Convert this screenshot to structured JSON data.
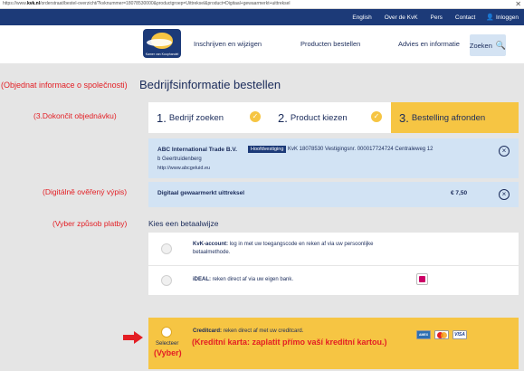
{
  "browser": {
    "url_prefix": "https://www.",
    "url_domain": "kvk.nl",
    "url_rest": "/orderstraat/bestel-overzicht/?kvknummer=18078530000&productgroep=Uittreksel&product=Digitaal+gewaarmerkt+uittreksel",
    "close": "✕"
  },
  "topbar": {
    "links": [
      "English",
      "Over de KvK",
      "Pers",
      "Contact"
    ],
    "login": "Inloggen",
    "user_icon": "👤"
  },
  "logo": {
    "text": "Kamer van Koophandel"
  },
  "nav": {
    "items": [
      "Inschrijven en wijzigen",
      "Producten bestellen",
      "Advies en informatie"
    ],
    "search": "Zoeken",
    "search_icon": "🔍"
  },
  "page": {
    "title": "Bedrijfsinformatie bestellen"
  },
  "annotations": {
    "order_info": "(Objednat informace o společnosti)",
    "complete_order": "(3.Dokončit objednávku)",
    "digital_extract": "(Digitálně ověřený výpis)",
    "payment_method": "(Vyber způsob platby)",
    "select": "(Vyber)",
    "credit_card": "(Kreditní karta: ",
    "credit_card_rest": "zaplatit přímo vaší kreditní kartou.)"
  },
  "steps": [
    {
      "num": "1.",
      "label": "Bedrijf zoeken",
      "check": "✓"
    },
    {
      "num": "2.",
      "label": "Product kiezen",
      "check": "✓"
    },
    {
      "num": "3.",
      "label": "Bestelling afronden"
    }
  ],
  "company": {
    "name": "ABC International Trade B.V.",
    "badge": "Hoofdvestiging",
    "info": "KvK 18078530   Vestigingsnr. 000017724724   Centraleweg 12",
    "address2": "b  Geertruidenberg",
    "website": "http://www.abcgeluid.eu"
  },
  "product": {
    "name": "Digitaal gewaarmerkt uittreksel",
    "price": "€ 7,50"
  },
  "payment": {
    "heading": "Kies een betaalwijze",
    "options": [
      {
        "title": "KvK-account:",
        "text": "log in met uw toegangscode en reken af via uw persoonlijke",
        "text2": "betaalmethode."
      },
      {
        "title": "iDEAL:",
        "text": "reken direct af via uw eigen bank."
      },
      {
        "title": "Creditcard:",
        "text": "reken direct af met uw creditcard."
      }
    ],
    "select_label": "Selecteer",
    "cards": [
      "AMEX",
      "MasterCard",
      "VISA"
    ]
  },
  "colors": {
    "navy": "#1c3a78",
    "accent_yellow": "#f6c543",
    "light_blue": "#d2e3f4",
    "annotation_red": "#e31e24"
  }
}
